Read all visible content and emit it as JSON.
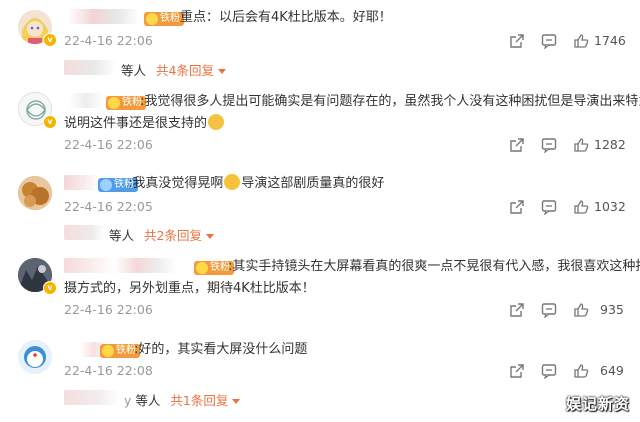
{
  "comments": [
    {
      "text": "重点：以后会有4K杜比版本。好耶！",
      "date": "22-4-16 22:06",
      "likes": "1746",
      "fan_badge": "铁粉",
      "reply": {
        "who": "等人",
        "count": "共4条回复"
      }
    },
    {
      "text_line1": ":我觉得很多人提出可能确实是有问题存在的，虽然我个人没有这种困扰但是导演出来特意",
      "text_line2": "说明这件事还是很支持的",
      "date": "22-4-16 22:06",
      "likes": "1282",
      "fan_badge": "铁粉"
    },
    {
      "text_a": ":我真没觉得晃啊",
      "text_b": "导演这部剧质量真的很好",
      "date": "22-4-16 22:05",
      "likes": "1032",
      "fan_badge": "铁粉",
      "reply": {
        "who": "等人",
        "count": "共2条回复"
      }
    },
    {
      "text_line1": ":其实手持镜头在大屏幕看真的很爽一点不晃很有代入感，我很喜欢这种拍",
      "text_line2": "摄方式的，另外划重点，期待4K杜比版本！",
      "date": "22-4-16 22:06",
      "likes": "935",
      "fan_badge": "铁粉"
    },
    {
      "text": ":好的，其实看大屏没什么问题",
      "date": "22-4-16 22:08",
      "likes": "649",
      "fan_badge": "铁粉",
      "reply": {
        "prefix": "y",
        "who": "等人",
        "count": "共1条回复"
      }
    }
  ],
  "watermark": "娱记新资",
  "colors": {
    "accent": "#eb7340",
    "meta": "#999999",
    "fan_badge_orange": "#f39b3c",
    "fan_badge_blue": "#4f9de8"
  },
  "icons": [
    "share-icon",
    "comment-icon",
    "like-icon"
  ]
}
